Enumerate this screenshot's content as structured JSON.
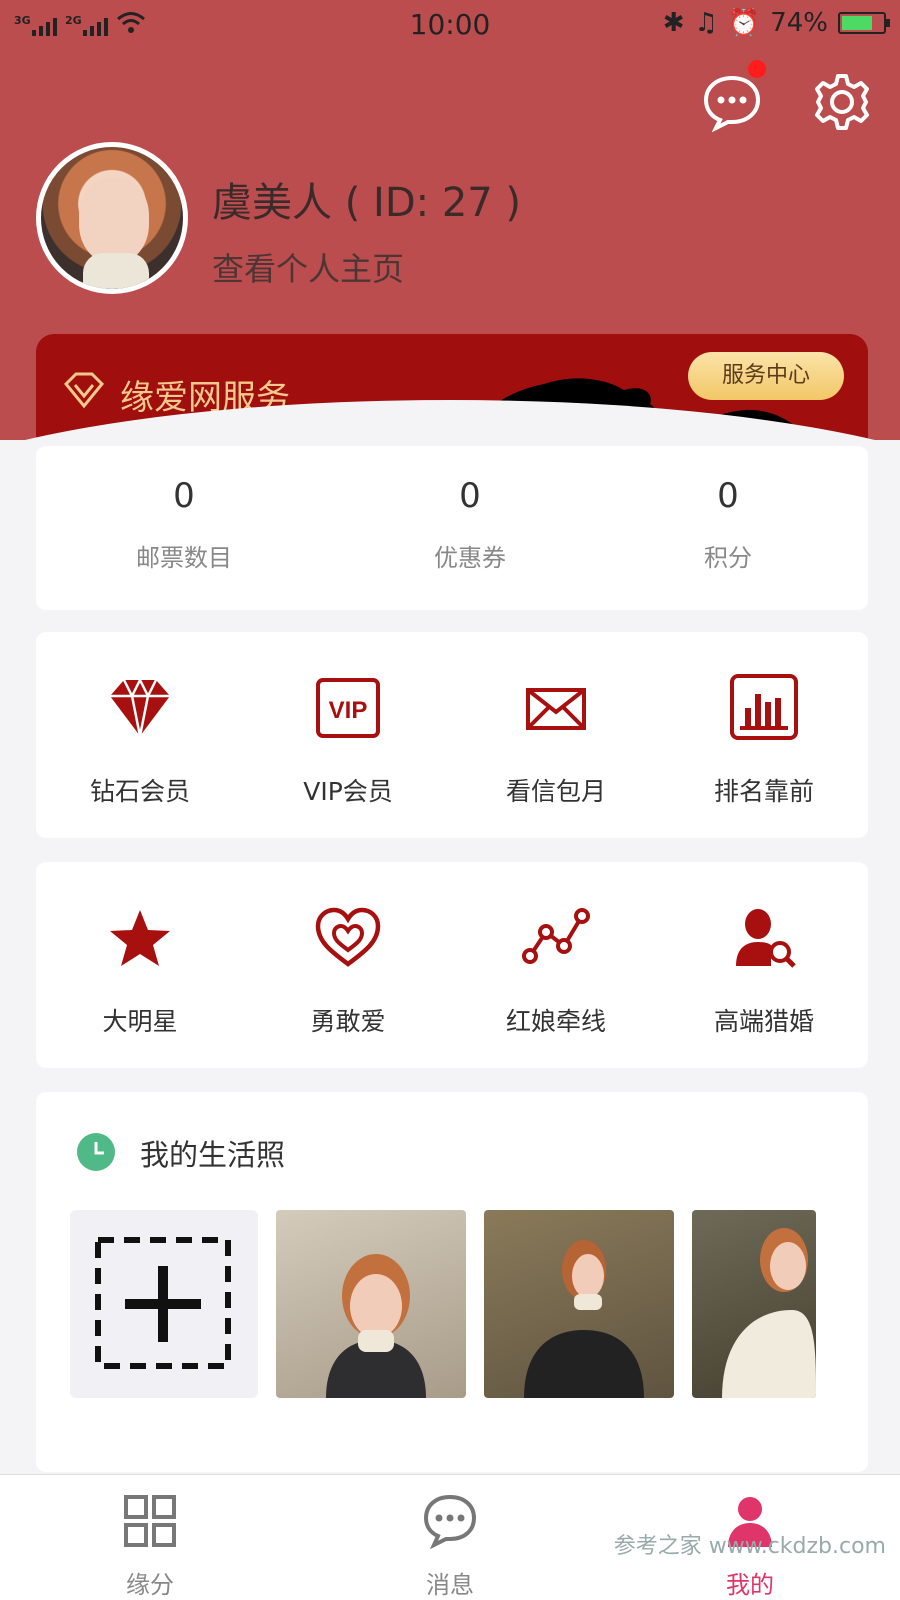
{
  "status_bar": {
    "network_1": "3G",
    "network_2": "2G",
    "time": "10:00",
    "battery": "74%",
    "battery_level": 0.74
  },
  "profile": {
    "name": "虞美人 ( ID: 27 )",
    "view_profile": "查看个人主页"
  },
  "service_banner": {
    "title": "缘爱网服务",
    "button": "服务中心"
  },
  "stats": [
    {
      "value": "0",
      "label": "邮票数目"
    },
    {
      "value": "0",
      "label": "优惠券"
    },
    {
      "value": "0",
      "label": "积分"
    }
  ],
  "membership": [
    {
      "label": "钻石会员",
      "icon": "diamond-icon"
    },
    {
      "label": "VIP会员",
      "icon": "vip-icon"
    },
    {
      "label": "看信包月",
      "icon": "envelope-icon"
    },
    {
      "label": "排名靠前",
      "icon": "ranking-chart-icon"
    }
  ],
  "features": [
    {
      "label": "大明星",
      "icon": "star-icon"
    },
    {
      "label": "勇敢爱",
      "icon": "heart-icon"
    },
    {
      "label": "红娘牵线",
      "icon": "connect-line-icon"
    },
    {
      "label": "高端猎婚",
      "icon": "user-search-icon"
    }
  ],
  "photos": {
    "title": "我的生活照"
  },
  "tabbar": [
    {
      "label": "缘分",
      "icon": "grid-icon",
      "active": false
    },
    {
      "label": "消息",
      "icon": "chat-icon",
      "active": false
    },
    {
      "label": "我的",
      "icon": "person-icon",
      "active": true
    }
  ],
  "watermark": "参考之家 www.ckdzb.com",
  "colors": {
    "header": "#bc4d4e",
    "banner": "#a00e0e",
    "accent_red": "#a80f0f",
    "active_tab": "#e0356a"
  }
}
